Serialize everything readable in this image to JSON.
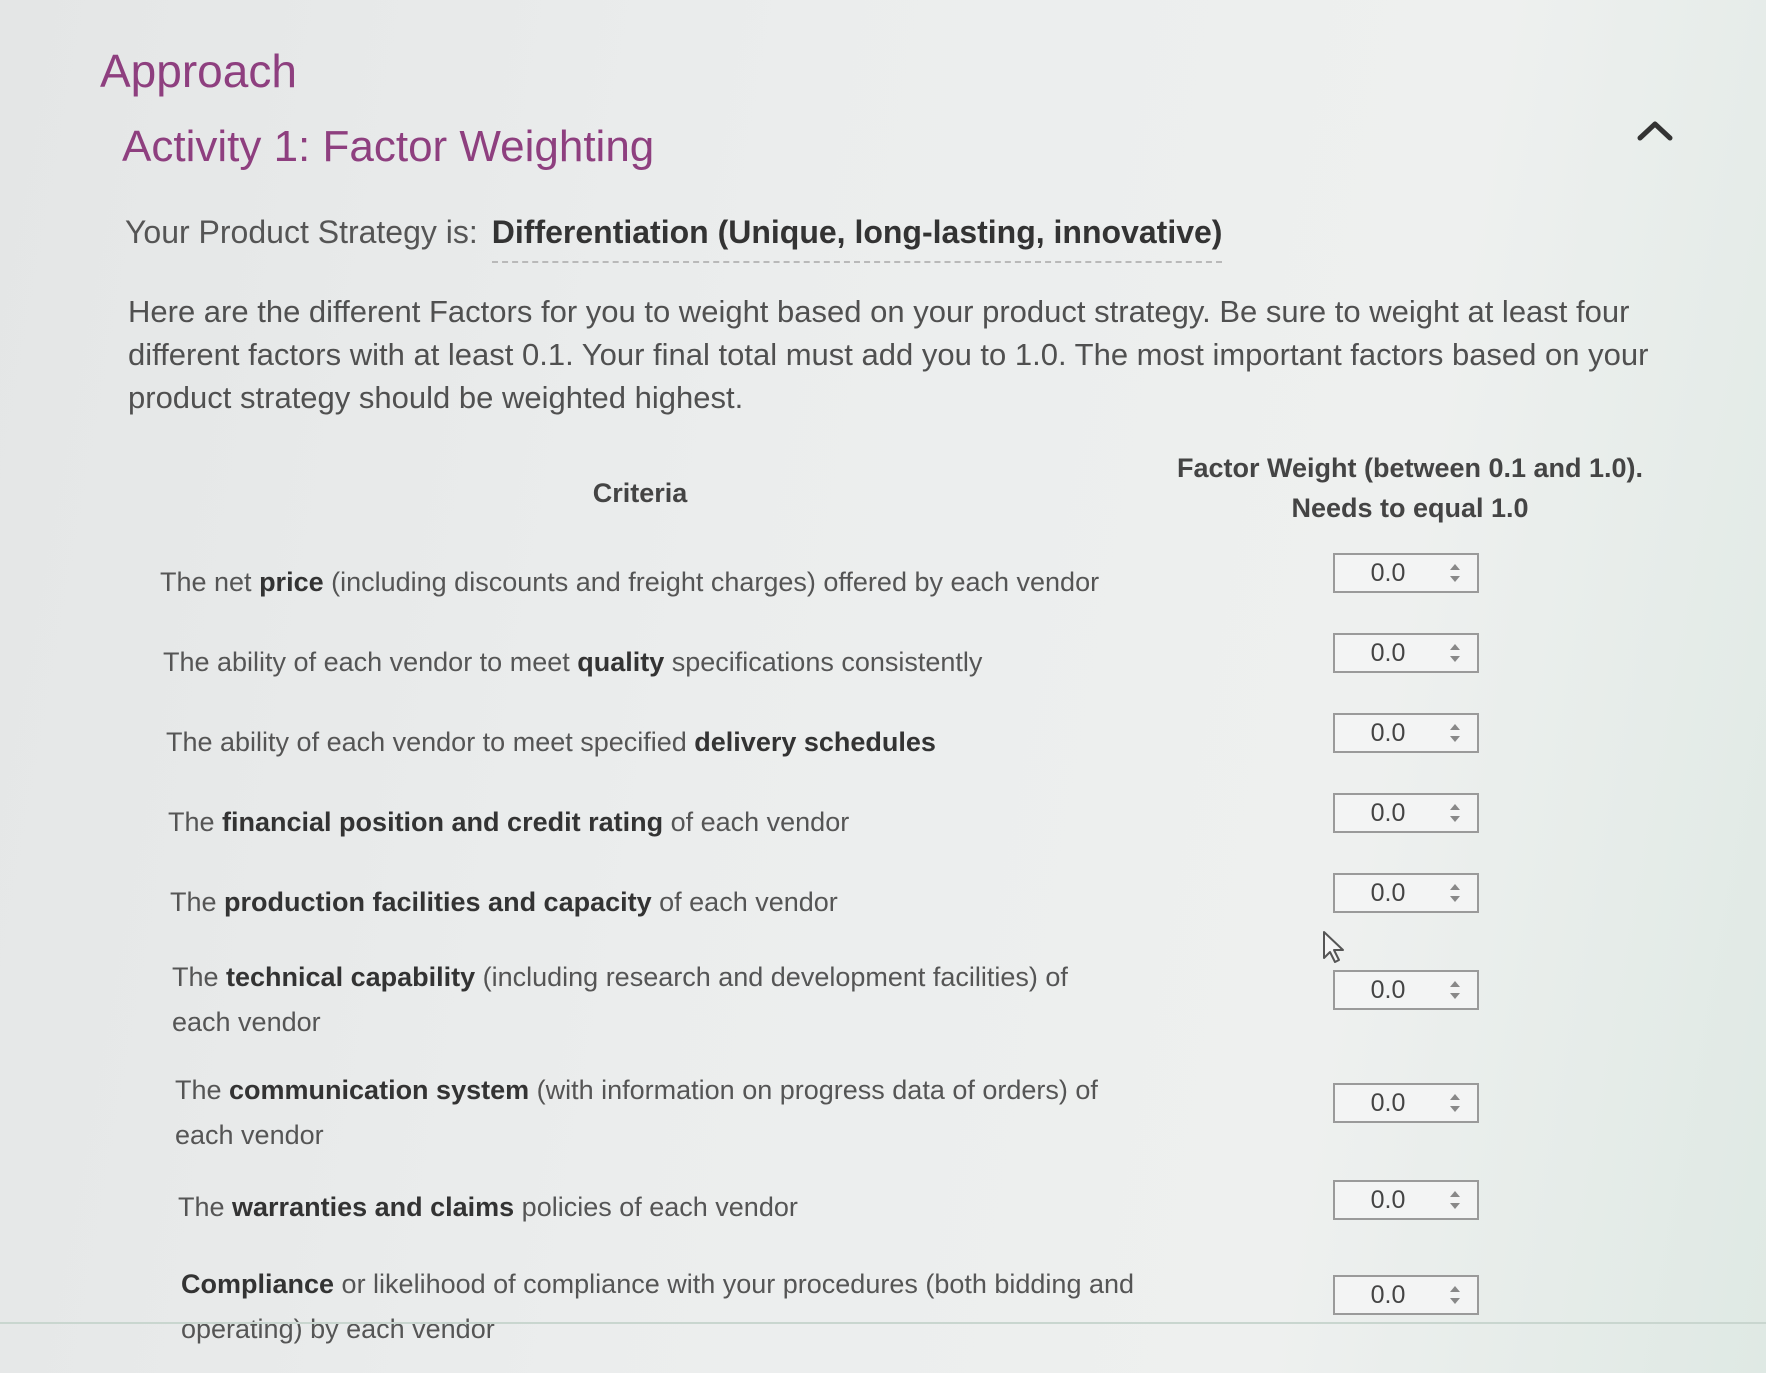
{
  "section_title": "Approach",
  "activity_title": "Activity 1: Factor Weighting",
  "strategy": {
    "label": "Your Product Strategy is:",
    "value": "Differentiation (Unique, long-lasting, innovative)"
  },
  "instructions": "Here are the different Factors for you to weight based on your product strategy. Be sure to weight at least four different factors with at least 0.1. Your final total must add you to 1.0. The most important factors based on your product strategy should be weighted highest.",
  "table": {
    "col_criteria": "Criteria",
    "col_weight": "Factor Weight (between 0.1 and 1.0). Needs to equal 1.0",
    "rows": [
      {
        "pre": "The net ",
        "bold": "price",
        "post": " (including discounts and freight charges) offered by each vendor",
        "weight": "0.0"
      },
      {
        "pre": "The ability of each vendor to meet ",
        "bold": "quality",
        "post": " specifications consistently",
        "weight": "0.0"
      },
      {
        "pre": "The ability of each vendor to meet specified ",
        "bold": "delivery schedules",
        "post": "",
        "weight": "0.0"
      },
      {
        "pre": "The ",
        "bold": "financial position and credit rating",
        "post": " of each vendor",
        "weight": "0.0"
      },
      {
        "pre": "The ",
        "bold": "production facilities and capacity",
        "post": " of each vendor",
        "weight": "0.0"
      },
      {
        "pre": "The ",
        "bold": "technical capability",
        "post": " (including research and development facilities) of each vendor",
        "weight": "0.0"
      },
      {
        "pre": "The ",
        "bold": "communication system",
        "post": " (with information on progress data of orders) of each vendor",
        "weight": "0.0"
      },
      {
        "pre": "The ",
        "bold": "warranties and claims",
        "post": " policies of each vendor",
        "weight": "0.0"
      },
      {
        "pre": "",
        "bold": "Compliance",
        "post": " or likelihood of compliance with your procedures (both bidding and operating) by each vendor",
        "weight": "0.0"
      }
    ]
  },
  "icons": {
    "collapse": "chevron-up-icon",
    "spinner": "spinner-arrows-icon",
    "cursor": "mouse-pointer-icon"
  },
  "colors": {
    "title": "#8e3f7f",
    "text": "#505050"
  }
}
